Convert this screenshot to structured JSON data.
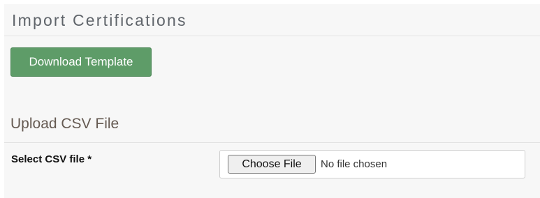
{
  "header": {
    "title": "Import Certifications"
  },
  "actions": {
    "download_template_label": "Download Template"
  },
  "upload": {
    "section_title": "Upload CSV File",
    "field_label": "Select CSV file *",
    "choose_file_label": "Choose File",
    "no_file_text": "No file chosen"
  },
  "colors": {
    "primary_button": "#5e9c68",
    "panel_background": "#f7f7f7",
    "title_text": "#5f646a"
  }
}
